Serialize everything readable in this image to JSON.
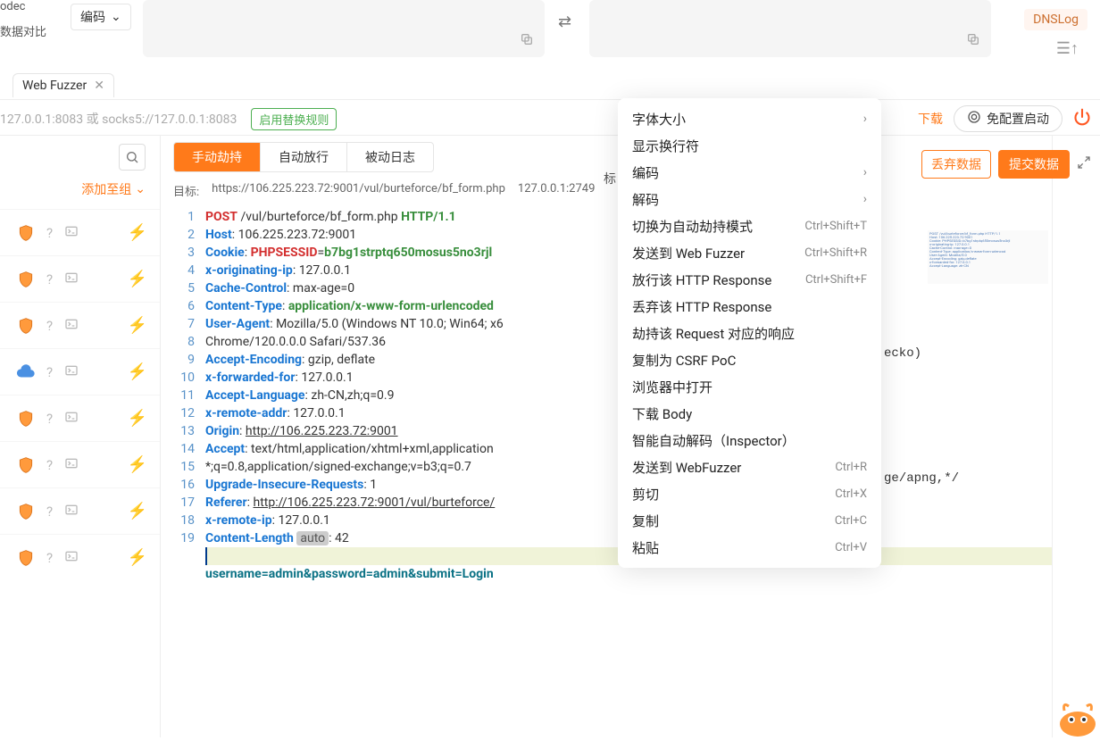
{
  "top": {
    "line1": "odec",
    "line2": "数据对比",
    "encode_dd": "编码",
    "dnslog": "DNSLog"
  },
  "tab": {
    "label": "Web Fuzzer"
  },
  "proxy": {
    "placeholder": "127.0.0.1:8083 或 socks5://127.0.0.1:8083",
    "enable_rule": "启用替换规则",
    "download": "下载",
    "config": "免配置启动"
  },
  "left": {
    "add_group": "添加至组"
  },
  "segments": {
    "manual": "手动劫持",
    "auto": "自动放行",
    "passive": "被动日志"
  },
  "target": {
    "label": "目标:",
    "url": "https://106.225.223.72:9001/vul/burteforce/bf_form.php",
    "addr": "127.0.0.1:2749"
  },
  "tag_label": "标",
  "code": {
    "method": "POST",
    "path": "/vul/burteforce/bf_form.php",
    "proto": "HTTP/1.1",
    "host_k": "Host",
    "host_v": "106.225.223.72:9001",
    "cookie_k": "Cookie",
    "sess_k": "PHPSESSID",
    "sess_v": "b7bg1strptq650mosus5no3rjl",
    "xorig_k": "x-originating-ip",
    "xorig_v": "127.0.0.1",
    "cache_k": "Cache-Control",
    "cache_v": "max-age=0",
    "ct_k": "Content-Type",
    "ct_v": "application/x-www-form-urlencoded",
    "ua_k": "User-Agent",
    "ua_v1": "Mozilla/5.0",
    "ua_v2": "(Windows NT 10.0; Win64; x6",
    "ua_v3": "Chrome/120.0.0.0 Safari/537.36",
    "enc_k": "Accept-Encoding",
    "enc_v": "gzip, deflate",
    "xff_k": "x-forwarded-for",
    "xff_v": "127.0.0.1",
    "lang_k": "Accept-Language",
    "lang_v": "zh-CN,zh;q=0.9",
    "xra_k": "x-remote-addr",
    "xra_v": "127.0.0.1",
    "origin_k": "Origin",
    "origin_v": "http://106.225.223.72:9001",
    "accept_k": "Accept",
    "accept_v1": "text/html,application/xhtml+xml,application",
    "accept_v2": "*;q=0.8,application/signed-exchange;v=b3;q=0.7",
    "uir_k1": "Upgrade-In",
    "uir_k2": "secure-Requests",
    "uir_v": "1",
    "ref_k": "Referer",
    "ref_v": "http://106.225.223.72:9001/vul/burteforce/",
    "xrip_k": "x-remote-ip",
    "xrip_v": "127.0.0.1",
    "cl_k": "Content-Length",
    "auto": "auto",
    "cl_v": "42",
    "body": "username=admin&password=admin&submit=Login",
    "gecko_tail": "ecko)",
    "apng_tail": "ge/apng,*/"
  },
  "actions": {
    "discard": "丢弃数据",
    "submit": "提交数据"
  },
  "menu": [
    {
      "label": "字体大小",
      "chev": true
    },
    {
      "label": "显示换行符"
    },
    {
      "label": "编码",
      "chev": true
    },
    {
      "label": "解码",
      "chev": true
    },
    {
      "label": "切换为自动劫持模式",
      "sc": "Ctrl+Shift+T"
    },
    {
      "label": "发送到 Web Fuzzer",
      "sc": "Ctrl+Shift+R"
    },
    {
      "label": "放行该 HTTP Response",
      "sc": "Ctrl+Shift+F"
    },
    {
      "label": "丢弃该 HTTP Response"
    },
    {
      "label": "劫持该 Request 对应的响应"
    },
    {
      "label": "复制为 CSRF PoC"
    },
    {
      "label": "浏览器中打开"
    },
    {
      "label": "下载 Body"
    },
    {
      "label": "智能自动解码（Inspector）"
    },
    {
      "label": "发送到 WebFuzzer",
      "sc": "Ctrl+R"
    },
    {
      "label": "剪切",
      "sc": "Ctrl+X"
    },
    {
      "label": "复制",
      "sc": "Ctrl+C"
    },
    {
      "label": "粘贴",
      "sc": "Ctrl+V"
    }
  ]
}
